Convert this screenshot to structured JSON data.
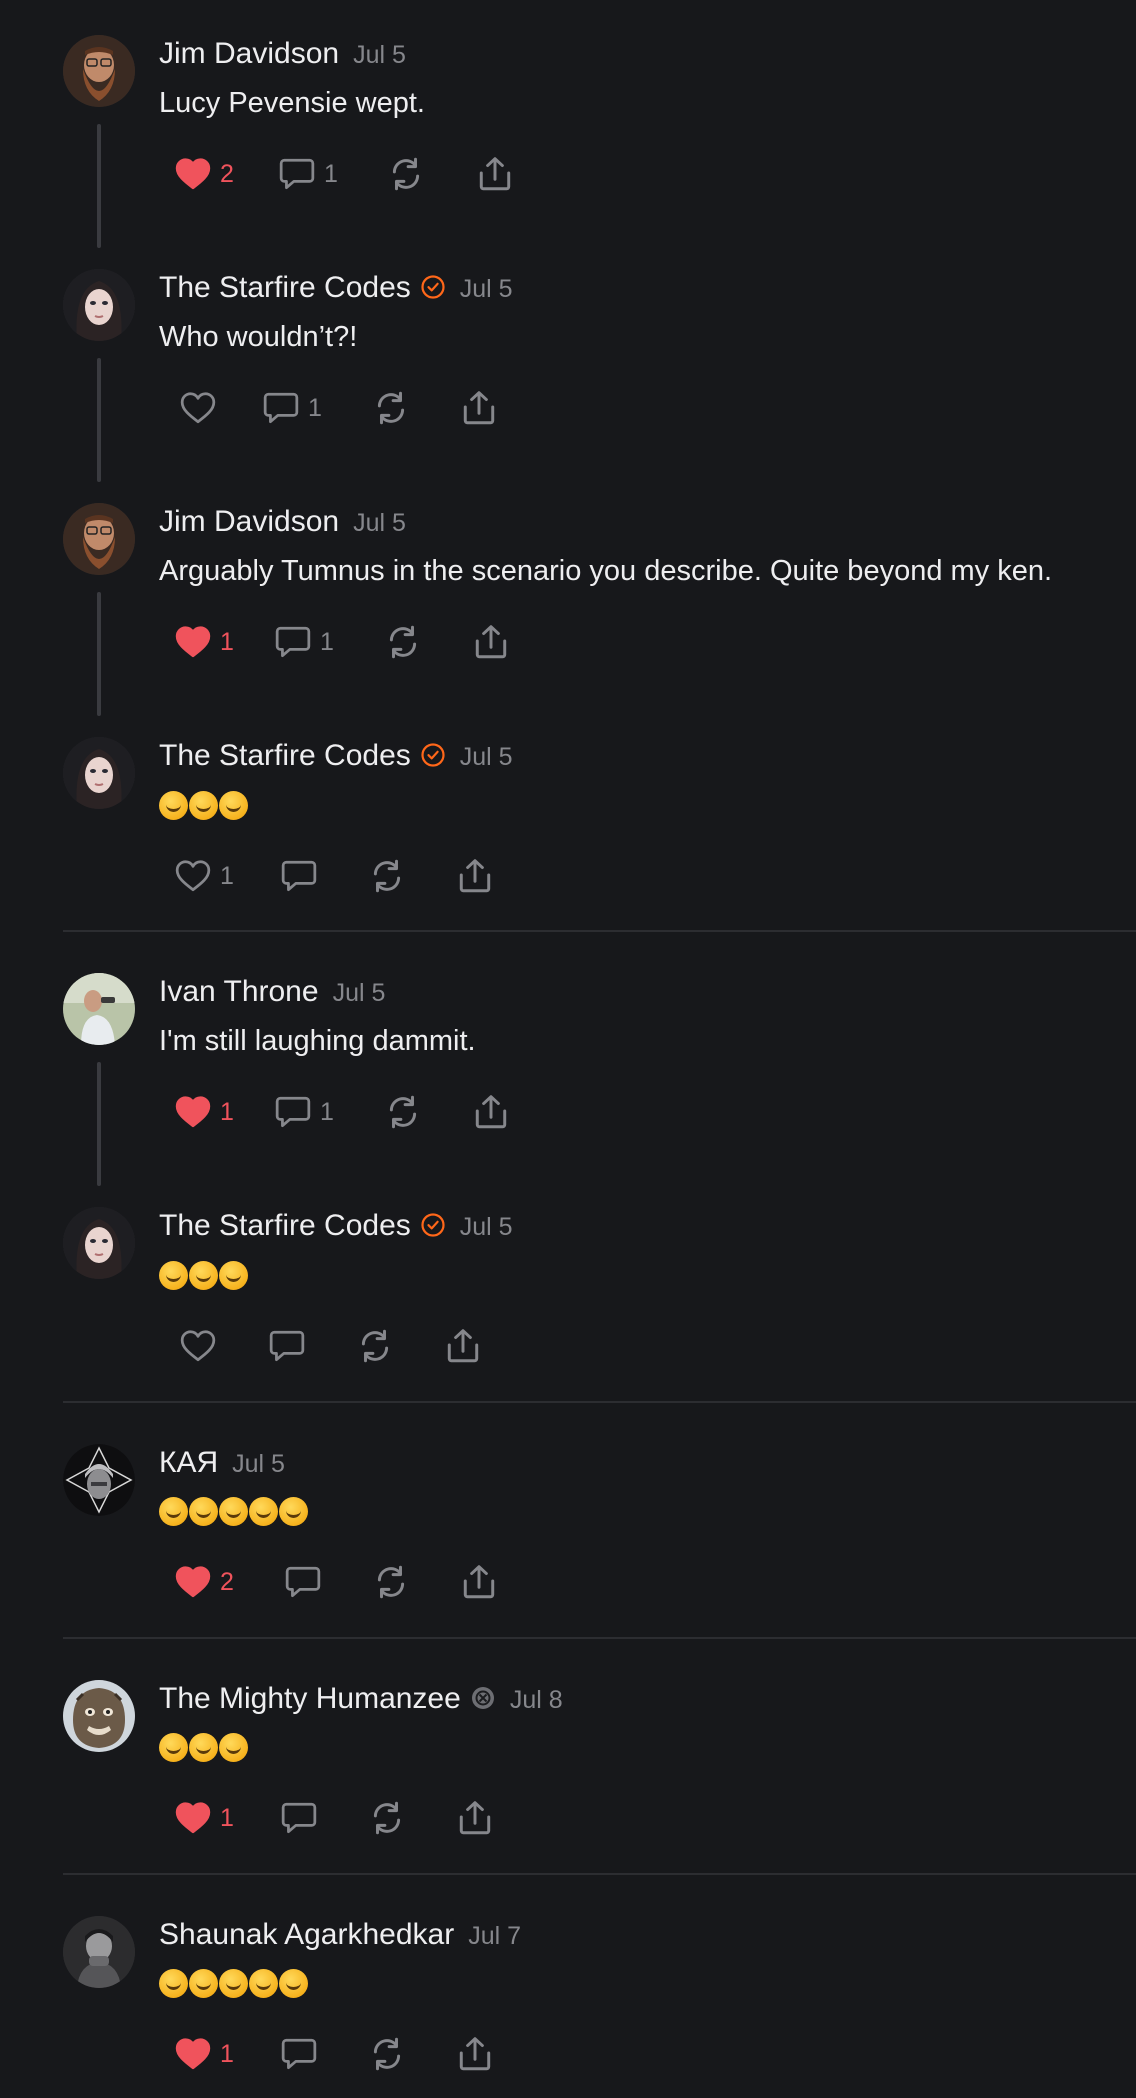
{
  "comments": [
    {
      "author": "Jim Davidson",
      "date": "Jul 5",
      "text": "Lucy Pevensie wept.",
      "likes": "2",
      "replies": "1"
    },
    {
      "author": "The Starfire Codes",
      "date": "Jul 5",
      "text": "Who wouldn’t?!",
      "likes": "",
      "replies": "1"
    },
    {
      "author": "Jim Davidson",
      "date": "Jul 5",
      "text": "Arguably Tumnus in the scenario you describe. Quite beyond my ken.",
      "likes": "1",
      "replies": "1"
    },
    {
      "author": "The Starfire Codes",
      "date": "Jul 5",
      "text": "🤣🤣🤣",
      "likes": "1",
      "replies": ""
    },
    {
      "author": "Ivan Throne",
      "date": "Jul 5",
      "text": "I'm still laughing dammit.",
      "likes": "1",
      "replies": "1"
    },
    {
      "author": "The Starfire Codes",
      "date": "Jul 5",
      "text": "🤣🤣🤣",
      "likes": "",
      "replies": ""
    },
    {
      "author": "КАЯ",
      "date": "Jul 5",
      "text": "🤣🤣🤣🤣🤣",
      "likes": "2",
      "replies": ""
    },
    {
      "author": "The Mighty Humanzee",
      "date": "Jul 8",
      "text": "🤣🤣🤣",
      "likes": "1",
      "replies": ""
    },
    {
      "author": "Shaunak Agarkhedkar",
      "date": "Jul 7",
      "text": "😂🤣😂🤣😂",
      "likes": "1",
      "replies": ""
    }
  ],
  "icons": {
    "like": "heart-icon",
    "reply": "comment-bubble-icon",
    "restack": "restack-icon",
    "share": "share-icon",
    "verified": "verified-check-icon",
    "mod_badge": "badge-icon"
  },
  "colors": {
    "background": "#17181b",
    "liked": "#f0535c",
    "muted": "#86878c",
    "verified": "#ff6719",
    "text": "#eeeef0"
  }
}
